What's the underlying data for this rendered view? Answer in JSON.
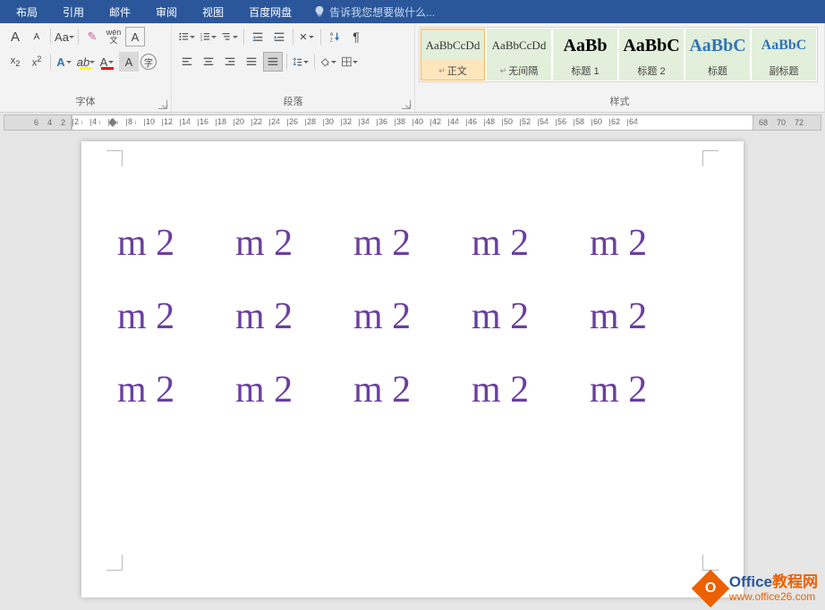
{
  "menu": {
    "tabs": [
      "布局",
      "引用",
      "邮件",
      "审阅",
      "视图",
      "百度网盘"
    ],
    "tell_me": "告诉我您想要做什么..."
  },
  "ribbon": {
    "font": {
      "label": "字体",
      "grow": "A",
      "shrink": "A",
      "case": "Aa",
      "clear": "✎",
      "phonetic": "wén",
      "charborder": "A",
      "subscript": "x₂",
      "superscript": "x²",
      "texteffects": "A",
      "highlight": "ab",
      "fontcolor": "A",
      "charshade": "A",
      "enclose": "字"
    },
    "para": {
      "label": "段落",
      "bullet": "•",
      "number": "1",
      "multilevel": "≡",
      "indent_dec": "≤",
      "indent_inc": "≥",
      "cnlist": "A",
      "sort": "↓",
      "showmarks": "¶",
      "align_l": "≡",
      "align_c": "≡",
      "align_r": "≡",
      "align_j": "≡",
      "align_d": "≡",
      "linespace": "↕",
      "shade": "▢",
      "border": "▦"
    },
    "styles": {
      "label": "样式",
      "items": [
        {
          "preview": "AaBbCcDd",
          "name": "正文",
          "cls": "",
          "sel": true
        },
        {
          "preview": "AaBbCcDd",
          "name": "无间隔",
          "cls": ""
        },
        {
          "preview": "AaBb",
          "name": "标题 1",
          "cls": "big"
        },
        {
          "preview": "AaBbC",
          "name": "标题 2",
          "cls": "big"
        },
        {
          "preview": "AaBbC",
          "name": "标题",
          "cls": "big blue"
        },
        {
          "preview": "AaBbC",
          "name": "副标题",
          "cls": "blue"
        }
      ]
    }
  },
  "ruler": {
    "left": [
      "6",
      "4",
      "2"
    ],
    "marks": [
      "2",
      "4",
      "6",
      "8",
      "10",
      "12",
      "14",
      "16",
      "18",
      "20",
      "22",
      "24",
      "26",
      "28",
      "30",
      "32",
      "34",
      "36",
      "38",
      "40",
      "42",
      "44",
      "46",
      "48",
      "50",
      "52",
      "54",
      "56",
      "58",
      "60",
      "62",
      "64"
    ],
    "right": [
      "68",
      "70",
      "72"
    ]
  },
  "document": {
    "cells": [
      "m 2",
      "m 2",
      "m 2",
      "m 2",
      "m 2",
      "m 2",
      "m 2",
      "m 2",
      "m 2",
      "m 2",
      "m 2",
      "m 2",
      "m 2",
      "m 2",
      "m 2"
    ]
  },
  "watermark": {
    "line1a": "Office",
    "line1b": "教程网",
    "line2": "www.office26.com"
  }
}
